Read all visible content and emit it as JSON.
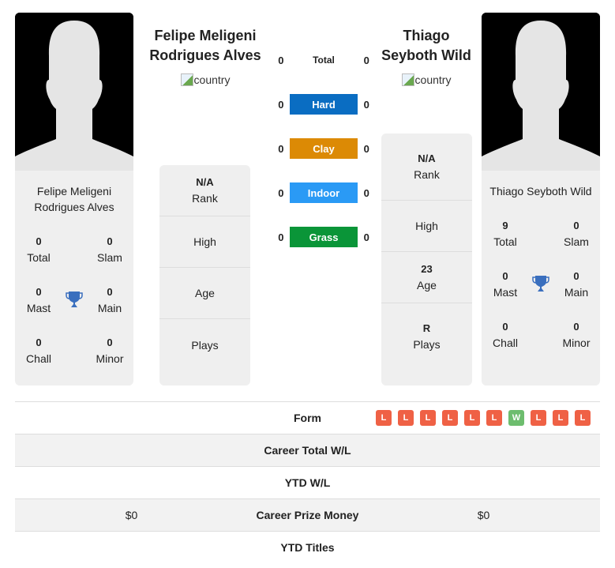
{
  "colors": {
    "hard": "#0a6dc2",
    "clay": "#dc8a05",
    "indoor": "#2a9af5",
    "grass": "#0a9538",
    "loss": "#ef6145",
    "win": "#6dbd6e",
    "trophy": "#3a6fbe"
  },
  "player1": {
    "name": "Felipe Meligeni Rodrigues Alves",
    "name_line1": "Felipe Meligeni",
    "name_line2": "Rodrigues Alves",
    "flag_alt": "country",
    "stats": {
      "total": {
        "value": "0",
        "label": "Total"
      },
      "slam": {
        "value": "0",
        "label": "Slam"
      },
      "mast": {
        "value": "0",
        "label": "Mast"
      },
      "main": {
        "value": "0",
        "label": "Main"
      },
      "chall": {
        "value": "0",
        "label": "Chall"
      },
      "minor": {
        "value": "0",
        "label": "Minor"
      }
    },
    "info": {
      "rank": {
        "value": "N/A",
        "label": "Rank"
      },
      "high": {
        "value": "",
        "label": "High"
      },
      "age": {
        "value": "",
        "label": "Age"
      },
      "plays": {
        "value": "",
        "label": "Plays"
      }
    }
  },
  "player2": {
    "name": "Thiago Seyboth Wild",
    "name_line1": "Thiago",
    "name_line2": "Seyboth Wild",
    "flag_alt": "country",
    "stats": {
      "total": {
        "value": "9",
        "label": "Total"
      },
      "slam": {
        "value": "0",
        "label": "Slam"
      },
      "mast": {
        "value": "0",
        "label": "Mast"
      },
      "main": {
        "value": "0",
        "label": "Main"
      },
      "chall": {
        "value": "0",
        "label": "Chall"
      },
      "minor": {
        "value": "0",
        "label": "Minor"
      }
    },
    "info": {
      "rank": {
        "value": "N/A",
        "label": "Rank"
      },
      "high": {
        "value": "",
        "label": "High"
      },
      "age": {
        "value": "23",
        "label": "Age"
      },
      "plays": {
        "value": "R",
        "label": "Plays"
      }
    }
  },
  "h2h": [
    {
      "label": "Total",
      "p1": "0",
      "p2": "0"
    },
    {
      "label": "Hard",
      "p1": "0",
      "p2": "0"
    },
    {
      "label": "Clay",
      "p1": "0",
      "p2": "0"
    },
    {
      "label": "Indoor",
      "p1": "0",
      "p2": "0"
    },
    {
      "label": "Grass",
      "p1": "0",
      "p2": "0"
    }
  ],
  "table": {
    "form_label": "Form",
    "form": [
      "L",
      "L",
      "L",
      "L",
      "L",
      "L",
      "W",
      "L",
      "L",
      "L"
    ],
    "rows": [
      {
        "label": "Career Total W/L",
        "p1": "",
        "p2": ""
      },
      {
        "label": "YTD W/L",
        "p1": "",
        "p2": ""
      },
      {
        "label": "Career Prize Money",
        "p1": "$0",
        "p2": "$0"
      },
      {
        "label": "YTD Titles",
        "p1": "",
        "p2": ""
      }
    ]
  }
}
